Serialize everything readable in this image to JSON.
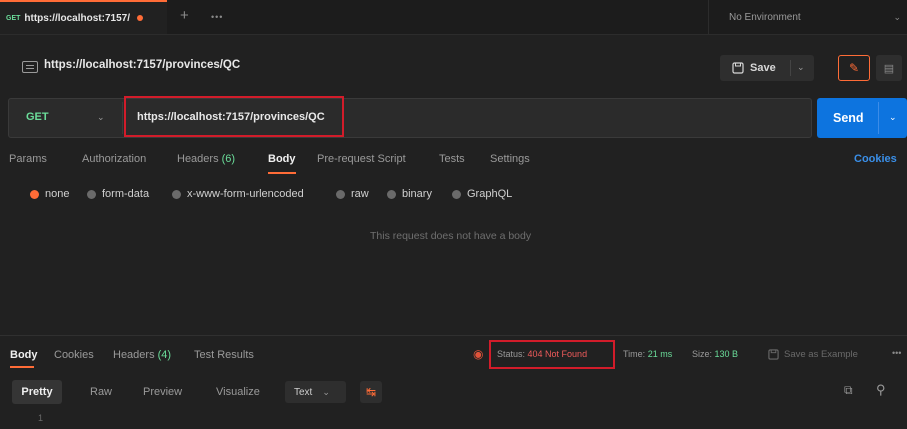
{
  "tabbar": {
    "active_tab": {
      "method": "GET",
      "title": "https://localhost:7157/",
      "unsaved_dot": true
    },
    "add_tab": "+",
    "more": "•••",
    "environment": "No Environment"
  },
  "request": {
    "title": "https://localhost:7157/provinces/QC",
    "save_label": "Save",
    "method": "GET",
    "url": "https://localhost:7157/provinces/QC",
    "send_label": "Send"
  },
  "request_tabs": [
    {
      "label": "Params"
    },
    {
      "label": "Authorization"
    },
    {
      "label": "Headers",
      "count": "(6)"
    },
    {
      "label": "Body",
      "active": true
    },
    {
      "label": "Pre-request Script"
    },
    {
      "label": "Tests"
    },
    {
      "label": "Settings"
    }
  ],
  "cookies_link": "Cookies",
  "body_types": [
    "none",
    "form-data",
    "x-www-form-urlencoded",
    "raw",
    "binary",
    "GraphQL"
  ],
  "body_selected": "none",
  "no_body_message": "This request does not have a body",
  "response": {
    "tabs": [
      {
        "label": "Body",
        "active": true
      },
      {
        "label": "Cookies"
      },
      {
        "label": "Headers",
        "count": "(4)"
      },
      {
        "label": "Test Results"
      }
    ],
    "status_label": "Status:",
    "status_value": "404 Not Found",
    "time_label": "Time:",
    "time_value": "21 ms",
    "size_label": "Size:",
    "size_value": "130 B",
    "save_example": "Save as Example",
    "more": "•••"
  },
  "view_toolbar": {
    "pretty": "Pretty",
    "raw": "Raw",
    "preview": "Preview",
    "visualize": "Visualize",
    "format": "Text"
  },
  "line_number": "1",
  "colors": {
    "accent": "#ff6c37",
    "send": "#0d74df",
    "method_get": "#6bdd9a",
    "highlight_box": "#d21c2a",
    "status_error": "#ef5b5b"
  }
}
